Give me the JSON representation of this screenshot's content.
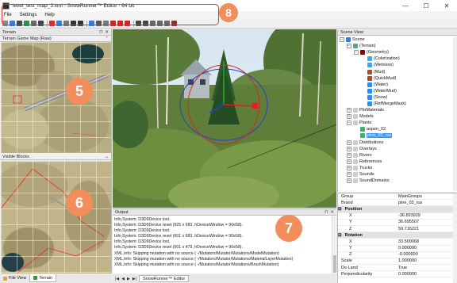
{
  "window": {
    "title": "level_test_map_3.xml - SnowRunner™ Editor - 64 bit",
    "controls": [
      "—",
      "☐",
      "✕"
    ]
  },
  "menu": [
    "File",
    "Settings",
    "Help"
  ],
  "toolbar": {
    "icon_colors": [
      "#888888",
      "#3a7bd5",
      "#444444",
      "#2e8b57",
      "#666666",
      "#444444",
      "#cc3333",
      "#3a7bd5",
      "#777777",
      "#333333",
      "#333333",
      "#3a7bd5",
      "#555555",
      "#777777",
      "#cc2222",
      "#cc2222",
      "#cc2222",
      "#444444",
      "#444444",
      "#666666",
      "#666666",
      "#666666",
      "#8b3030"
    ]
  },
  "callouts": {
    "c5": "5",
    "c6": "6",
    "c7": "7",
    "c8": "8"
  },
  "panels": {
    "terrain_title": "Terrain",
    "terrain_map_title": "Terrain Game Map (Raw)",
    "visible_blocks_title": "Visible Blocks",
    "output_title": "Output",
    "scene_view_title": "Scene View"
  },
  "left_tabs": [
    "File View",
    "Terrain"
  ],
  "bottom_tab": "SnowRunner™ Editor",
  "output_lines": [
    "Info,System: D3D9Device lost.",
    "Info,System: D3D9Device reset (925 x 683, hDeviceWindow = 90e58).",
    "Info,System: D3D9Device lost.",
    "Info,System: D3D9Device reset (601 x 683, hDeviceWindow = 90e58).",
    "Info,System: D3D9Device lost.",
    "Info,System: D3D9Device reset (601 x 479, hDeviceWindow = 90e58).",
    "XML,Info: Skipping mutation with no source ( -/Mutators/Mutator/Mutations/ModelMutation)",
    "XML,Info: Skipping mutation with no source ( -/Mutators/Mutator/Mutations/MaterialLayerMutation)",
    "XML,Info: Skipping mutation with no source ( -/Mutators/Mutator/Mutations/BrushMutation)"
  ],
  "scene_tree": [
    {
      "label": "Scene",
      "depth": 0,
      "exp": "−",
      "icon": "#3a7bd5"
    },
    {
      "label": "(Terrain)",
      "depth": 1,
      "exp": "−",
      "icon": "#5f9ea0"
    },
    {
      "label": "(Geometry)",
      "depth": 2,
      "exp": "−",
      "icon": "#8b0000"
    },
    {
      "label": "(Colorization)",
      "depth": 3,
      "exp": "",
      "icon": "#4aa3df"
    },
    {
      "label": "(Wetness)",
      "depth": 3,
      "exp": "",
      "icon": "#4aa3df"
    },
    {
      "label": "(Mud)",
      "depth": 3,
      "exp": "",
      "icon": "#a0522d"
    },
    {
      "label": "(QuickMud)",
      "depth": 3,
      "exp": "",
      "icon": "#a0522d"
    },
    {
      "label": "(Water)",
      "depth": 3,
      "exp": "",
      "icon": "#1e90ff"
    },
    {
      "label": "(WaterMud)",
      "depth": 3,
      "exp": "",
      "icon": "#1e90ff"
    },
    {
      "label": "(Snow)",
      "depth": 3,
      "exp": "",
      "icon": "#1e90ff"
    },
    {
      "label": "(RefMergeMask)",
      "depth": 3,
      "exp": "",
      "icon": "#1e90ff"
    },
    {
      "label": "PbrMaterials",
      "depth": 1,
      "exp": "+",
      "icon": "#cccccc"
    },
    {
      "label": "Models",
      "depth": 1,
      "exp": "+",
      "icon": "#cccccc"
    },
    {
      "label": "Plants",
      "depth": 1,
      "exp": "−",
      "icon": "#cccccc"
    },
    {
      "label": "aspen_02",
      "depth": 2,
      "exp": "",
      "icon": "#3cb371"
    },
    {
      "label": "pine_03_rus",
      "depth": 2,
      "exp": "",
      "icon": "#3cb371",
      "selected": true
    },
    {
      "label": "Distributions",
      "depth": 1,
      "exp": "+",
      "icon": "#cccccc"
    },
    {
      "label": "Overlays",
      "depth": 1,
      "exp": "+",
      "icon": "#cccccc"
    },
    {
      "label": "Rivers",
      "depth": 1,
      "exp": "+",
      "icon": "#cccccc"
    },
    {
      "label": "References",
      "depth": 1,
      "exp": "+",
      "icon": "#cccccc"
    },
    {
      "label": "Trucks",
      "depth": 1,
      "exp": "+",
      "icon": "#cccccc"
    },
    {
      "label": "Sounds",
      "depth": 1,
      "exp": "+",
      "icon": "#cccccc"
    },
    {
      "label": "SoundDomains",
      "depth": 1,
      "exp": "+",
      "icon": "#cccccc"
    }
  ],
  "properties": [
    {
      "k": "Group",
      "v": "MainGroups"
    },
    {
      "k": "Brand",
      "v": "pine_03_rus"
    },
    {
      "section": "Position"
    },
    {
      "k": "X",
      "v": "-36.893929",
      "indent": true
    },
    {
      "k": "Y",
      "v": "36.695507",
      "indent": true
    },
    {
      "k": "Z",
      "v": "59.716221",
      "indent": true
    },
    {
      "section": "Rotation"
    },
    {
      "k": "X",
      "v": "33.509068",
      "indent": true
    },
    {
      "k": "Y",
      "v": "0.000000",
      "indent": true
    },
    {
      "k": "Z",
      "v": "-0.000000",
      "indent": true
    },
    {
      "k": "Scale",
      "v": "1.000000"
    },
    {
      "k": "Do Land",
      "v": "True"
    },
    {
      "k": "Perpendicularity",
      "v": "0.000000"
    }
  ]
}
